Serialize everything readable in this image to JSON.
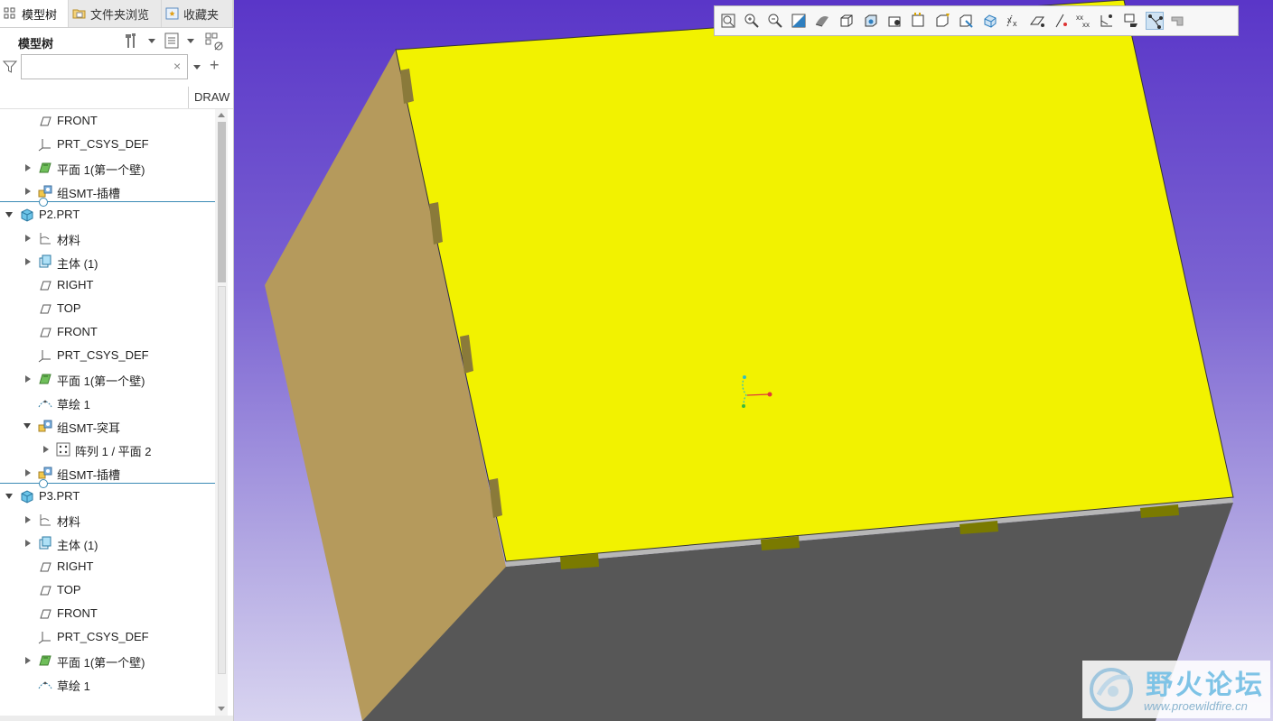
{
  "tabs": [
    {
      "label": "模型树",
      "icon": "model-tree-icon"
    },
    {
      "label": "文件夹浏览",
      "icon": "folder-browser-icon"
    },
    {
      "label": "收藏夹",
      "icon": "favorites-icon"
    }
  ],
  "panel": {
    "title": "模型树",
    "search": {
      "value": "",
      "placeholder": ""
    },
    "column_header": "DRAW"
  },
  "tree": [
    {
      "label": "FRONT",
      "icon": "datum-plane-icon",
      "depth": 1,
      "expander": "none"
    },
    {
      "label": "PRT_CSYS_DEF",
      "icon": "csys-icon",
      "depth": 1,
      "expander": "none"
    },
    {
      "label": "平面 1(第一个壁)",
      "icon": "flat-wall-icon",
      "depth": 1,
      "expander": "collapsed"
    },
    {
      "label": "组SMT-插槽",
      "icon": "group-icon",
      "depth": 1,
      "expander": "collapsed"
    },
    {
      "label": "P2.PRT",
      "icon": "part-icon",
      "depth": 0,
      "expander": "expanded"
    },
    {
      "label": "材料",
      "icon": "material-icon",
      "depth": 1,
      "expander": "collapsed"
    },
    {
      "label": "主体 (1)",
      "icon": "body-icon",
      "depth": 1,
      "expander": "collapsed"
    },
    {
      "label": "RIGHT",
      "icon": "datum-plane-icon",
      "depth": 1,
      "expander": "none"
    },
    {
      "label": "TOP",
      "icon": "datum-plane-icon",
      "depth": 1,
      "expander": "none"
    },
    {
      "label": "FRONT",
      "icon": "datum-plane-icon",
      "depth": 1,
      "expander": "none"
    },
    {
      "label": "PRT_CSYS_DEF",
      "icon": "csys-icon",
      "depth": 1,
      "expander": "none"
    },
    {
      "label": "平面 1(第一个壁)",
      "icon": "flat-wall-icon",
      "depth": 1,
      "expander": "collapsed"
    },
    {
      "label": "草绘 1",
      "icon": "sketch-icon",
      "depth": 1,
      "expander": "none"
    },
    {
      "label": "组SMT-突耳",
      "icon": "group-icon",
      "depth": 1,
      "expander": "expanded"
    },
    {
      "label": "阵列 1 / 平面 2",
      "icon": "pattern-icon",
      "depth": 2,
      "expander": "collapsed"
    },
    {
      "label": "组SMT-插槽",
      "icon": "group-icon",
      "depth": 1,
      "expander": "collapsed"
    },
    {
      "label": "P3.PRT",
      "icon": "part-icon",
      "depth": 0,
      "expander": "expanded"
    },
    {
      "label": "材料",
      "icon": "material-icon",
      "depth": 1,
      "expander": "collapsed"
    },
    {
      "label": "主体 (1)",
      "icon": "body-icon",
      "depth": 1,
      "expander": "collapsed"
    },
    {
      "label": "RIGHT",
      "icon": "datum-plane-icon",
      "depth": 1,
      "expander": "none"
    },
    {
      "label": "TOP",
      "icon": "datum-plane-icon",
      "depth": 1,
      "expander": "none"
    },
    {
      "label": "FRONT",
      "icon": "datum-plane-icon",
      "depth": 1,
      "expander": "none"
    },
    {
      "label": "PRT_CSYS_DEF",
      "icon": "csys-icon",
      "depth": 1,
      "expander": "none"
    },
    {
      "label": "平面 1(第一个壁)",
      "icon": "flat-wall-icon",
      "depth": 1,
      "expander": "collapsed"
    },
    {
      "label": "草绘 1",
      "icon": "sketch-icon",
      "depth": 1,
      "expander": "none"
    }
  ],
  "view_toolbar": [
    "refit-icon",
    "zoom-in-icon",
    "zoom-out-icon",
    "repaint-icon",
    "display-style-icon",
    "saved-orientations-icon",
    "view-manager-icon",
    "perspective-icon",
    "spin-center-icon",
    "annotation-display-icon",
    "plane-display-icon",
    "axis-display-icon",
    "point-display-icon",
    "csys-display-icon",
    "note-display-icon",
    "datum-display-icon",
    "selected-display-icon",
    "tag-display-icon",
    "pause-icon",
    "skeleton-icon"
  ],
  "watermark": {
    "title": "野火论坛",
    "url": "www.proewildfire.cn"
  },
  "colors": {
    "viewport_top": "#5a36c8",
    "viewport_bottom": "#d8d4f0",
    "face_top": "#f2f200",
    "face_left": "#b59a5c",
    "face_front": "#575757",
    "tree_divider": "#3b8ab5"
  }
}
